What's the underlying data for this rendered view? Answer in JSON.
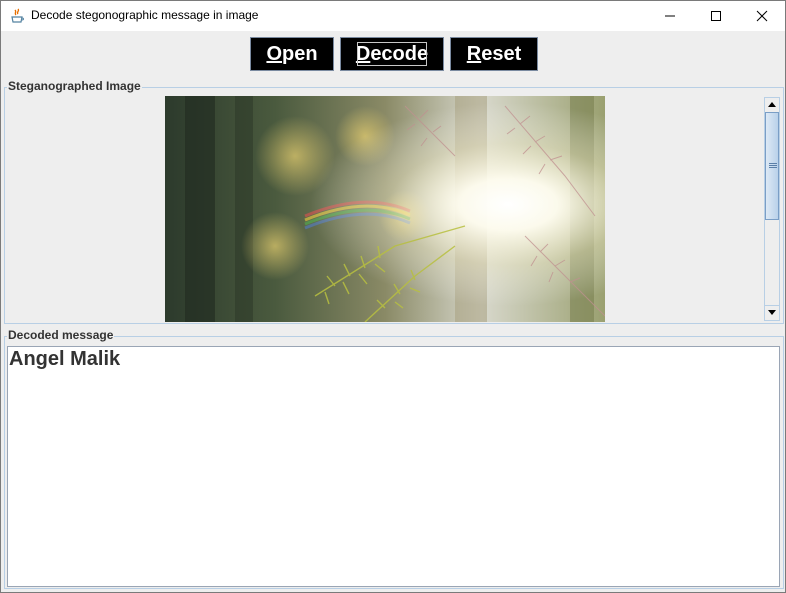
{
  "window": {
    "title": "Decode stegonographic message in image",
    "controls": [
      "minimize-icon",
      "maximize-icon",
      "close-icon"
    ]
  },
  "toolbar": {
    "open": {
      "mnemonic": "O",
      "rest": "pen"
    },
    "decode": {
      "mnemonic": "D",
      "rest": "ecode"
    },
    "reset": {
      "mnemonic": "R",
      "rest": "eset"
    }
  },
  "image_panel": {
    "label": "Steganographed Image",
    "image_alt_icon": "forest-sunlight-photo"
  },
  "message_panel": {
    "label": "Decoded message",
    "text": "Angel Malik"
  },
  "colors": {
    "button_bg": "#000000",
    "button_text": "#ffffff",
    "panel_bg": "#eeeeee",
    "border": "#b8cfe5"
  }
}
